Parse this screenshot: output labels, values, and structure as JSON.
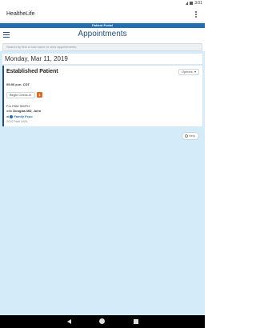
{
  "status_bar": {
    "time": "3:01"
  },
  "app_bar": {
    "title": "HealtheLife",
    "overflow_icon": "more-vert-icon"
  },
  "banner": {
    "text": "Patient Portal",
    "color": "#1f6fb2"
  },
  "header": {
    "title": "Appointments",
    "menu_icon": "hamburger-menu-icon",
    "accent": "#1f4f80"
  },
  "search": {
    "placeholder": "Search by first or last name to view appointments"
  },
  "content": {
    "background": "#d4ebf9",
    "date": "Monday, Mar 11, 2019",
    "appointment": {
      "type": "Established Patient",
      "options_label": "Options",
      "time": "05:00 p.m. CDT",
      "begin_checkin_label": "Begin Check-in",
      "checkin_badge": "1",
      "for_prefix": "For",
      "patient_name": "PAM SMITH",
      "with_prefix": "with",
      "provider": "Douglas MD, John",
      "at_prefix": "at",
      "location": "Family Fcoo",
      "address": "2022 Natl 4811"
    },
    "help_label": "Help"
  },
  "nav_bar": {
    "back_icon": "back-triangle-icon",
    "home_icon": "home-circle-icon",
    "recents_icon": "recents-square-icon"
  }
}
